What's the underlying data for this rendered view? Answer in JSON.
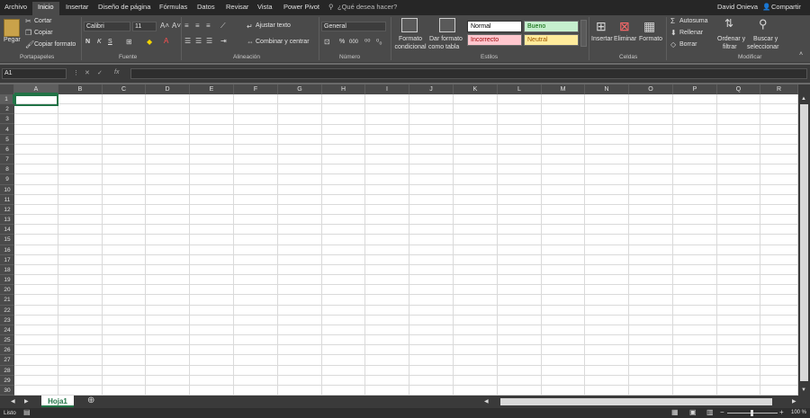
{
  "tabs": [
    "Archivo",
    "Inicio",
    "Insertar",
    "Diseño de página",
    "Fórmulas",
    "Datos",
    "Revisar",
    "Vista",
    "Power Pivot"
  ],
  "search_placeholder": "¿Qué desea hacer?",
  "user": "David Onieva",
  "share": "Compartir",
  "clipboard": {
    "paste": "Pegar",
    "cut": "Cortar",
    "copy": "Copiar",
    "format_painter": "Copiar formato",
    "group": "Portapapeles"
  },
  "font": {
    "name": "Calibri",
    "size": "11",
    "bold": "N",
    "italic": "K",
    "underline": "S",
    "group": "Fuente"
  },
  "alignment": {
    "wrap": "Ajustar texto",
    "merge": "Combinar y centrar",
    "group": "Alineación"
  },
  "number": {
    "format": "General",
    "percent": "%",
    "comma": "000",
    "group": "Número"
  },
  "styles": {
    "cond_format": [
      "Formato",
      "condicional"
    ],
    "table_format": [
      "Dar formato",
      "como tabla"
    ],
    "normal": "Normal",
    "good": "Bueno",
    "bad": "Incorrecto",
    "neutral": "Neutral",
    "group": "Estilos"
  },
  "cells": {
    "insert": "Insertar",
    "delete": "Eliminar",
    "format": "Formato",
    "group": "Celdas"
  },
  "editing": {
    "autosum": "Autosuma",
    "fill": "Rellenar",
    "clear": "Borrar",
    "sort": [
      "Ordenar y",
      "filtrar"
    ],
    "find": [
      "Buscar y",
      "seleccionar"
    ],
    "group": "Modificar"
  },
  "name_box": "A1",
  "fx": "fx",
  "columns": [
    "A",
    "B",
    "C",
    "D",
    "E",
    "F",
    "G",
    "H",
    "I",
    "J",
    "K",
    "L",
    "M",
    "N",
    "O",
    "P",
    "Q",
    "R"
  ],
  "rows": [
    "1",
    "2",
    "3",
    "4",
    "5",
    "6",
    "7",
    "8",
    "9",
    "10",
    "11",
    "12",
    "13",
    "14",
    "15",
    "16",
    "17",
    "18",
    "19",
    "20",
    "21",
    "22",
    "23",
    "24",
    "25",
    "26",
    "27",
    "28",
    "29",
    "30"
  ],
  "sheet": "Hoja1",
  "status": "Listo",
  "zoom": "100 %",
  "colors": {
    "tabbar": "#262626",
    "ribbon": "#4a4a4a",
    "accent": "#217346",
    "normal_bg": "#ffffff",
    "good_bg": "#c6efce",
    "good_fg": "#006100",
    "bad_bg": "#ffc7ce",
    "bad_fg": "#9c0006",
    "neutral_bg": "#ffeb9c",
    "neutral_fg": "#9c5700"
  }
}
